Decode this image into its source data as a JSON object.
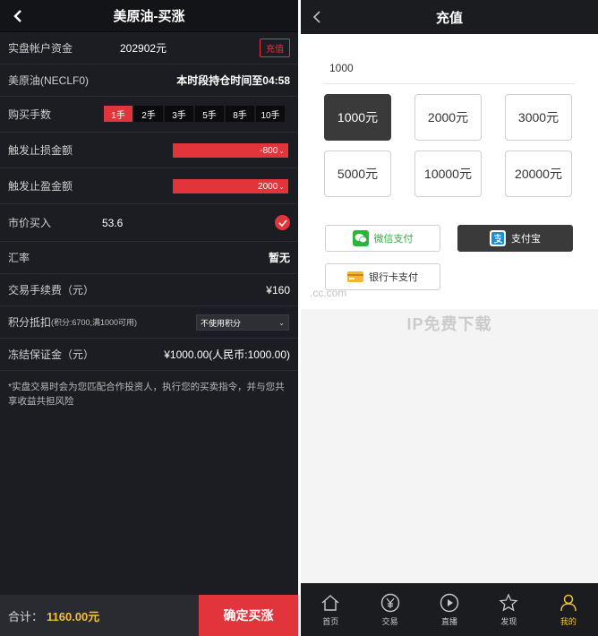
{
  "left": {
    "header": {
      "title": "美原油-买涨"
    },
    "account": {
      "label": "实盘帐户资金",
      "value": "202902元",
      "recharge_label": "充值"
    },
    "product": {
      "label": "美原油(NECLF0)",
      "info": "本时段持仓时间至04:58"
    },
    "lots": {
      "label": "购买手数",
      "options": [
        "1手",
        "2手",
        "3手",
        "5手",
        "8手",
        "10手"
      ],
      "selected": "1手"
    },
    "stop_loss": {
      "label": "触发止损金额",
      "value": "-800"
    },
    "take_profit": {
      "label": "触发止盈金额",
      "value": "2000"
    },
    "market_buy": {
      "label": "市价买入",
      "value": "53.6"
    },
    "rate": {
      "label": "汇率",
      "value": "暂无"
    },
    "fee": {
      "label": "交易手续费（元）",
      "value": "¥160"
    },
    "points": {
      "label": "积分抵扣",
      "detail": "(积分:6700,满1000可用)",
      "select_value": "不使用积分"
    },
    "deposit": {
      "label": "冻结保证金（元）",
      "value": "¥1000.00(人民币:1000.00)"
    },
    "notice": "*实盘交易时会为您匹配合作投资人，执行您的买卖指令，并与您共享收益共担风险",
    "footer": {
      "total_label": "合计：",
      "total_value": "1160.00元",
      "confirm_label": "确定买涨"
    }
  },
  "right": {
    "header": {
      "title": "充值"
    },
    "amount_input": "1000",
    "amounts": [
      "1000元",
      "2000元",
      "3000元",
      "5000元",
      "10000元",
      "20000元"
    ],
    "selected_amount": "1000元",
    "payments": {
      "wechat": "微信支付",
      "alipay": "支付宝",
      "bankcard": "银行卡支付"
    },
    "selected_payment": "支付宝",
    "watermark": "IP免费下载",
    "watermark_small": ".cc.com",
    "tabbar": [
      {
        "label": "首页",
        "icon": "home-icon"
      },
      {
        "label": "交易",
        "icon": "yen-coin-icon"
      },
      {
        "label": "直播",
        "icon": "play-icon"
      },
      {
        "label": "发现",
        "icon": "star-icon"
      },
      {
        "label": "我的",
        "icon": "user-icon"
      }
    ],
    "active_tab": "我的"
  },
  "colors": {
    "accent_red": "#e2353b",
    "gold": "#f0c23b",
    "dark_bg": "#1c1d22"
  }
}
